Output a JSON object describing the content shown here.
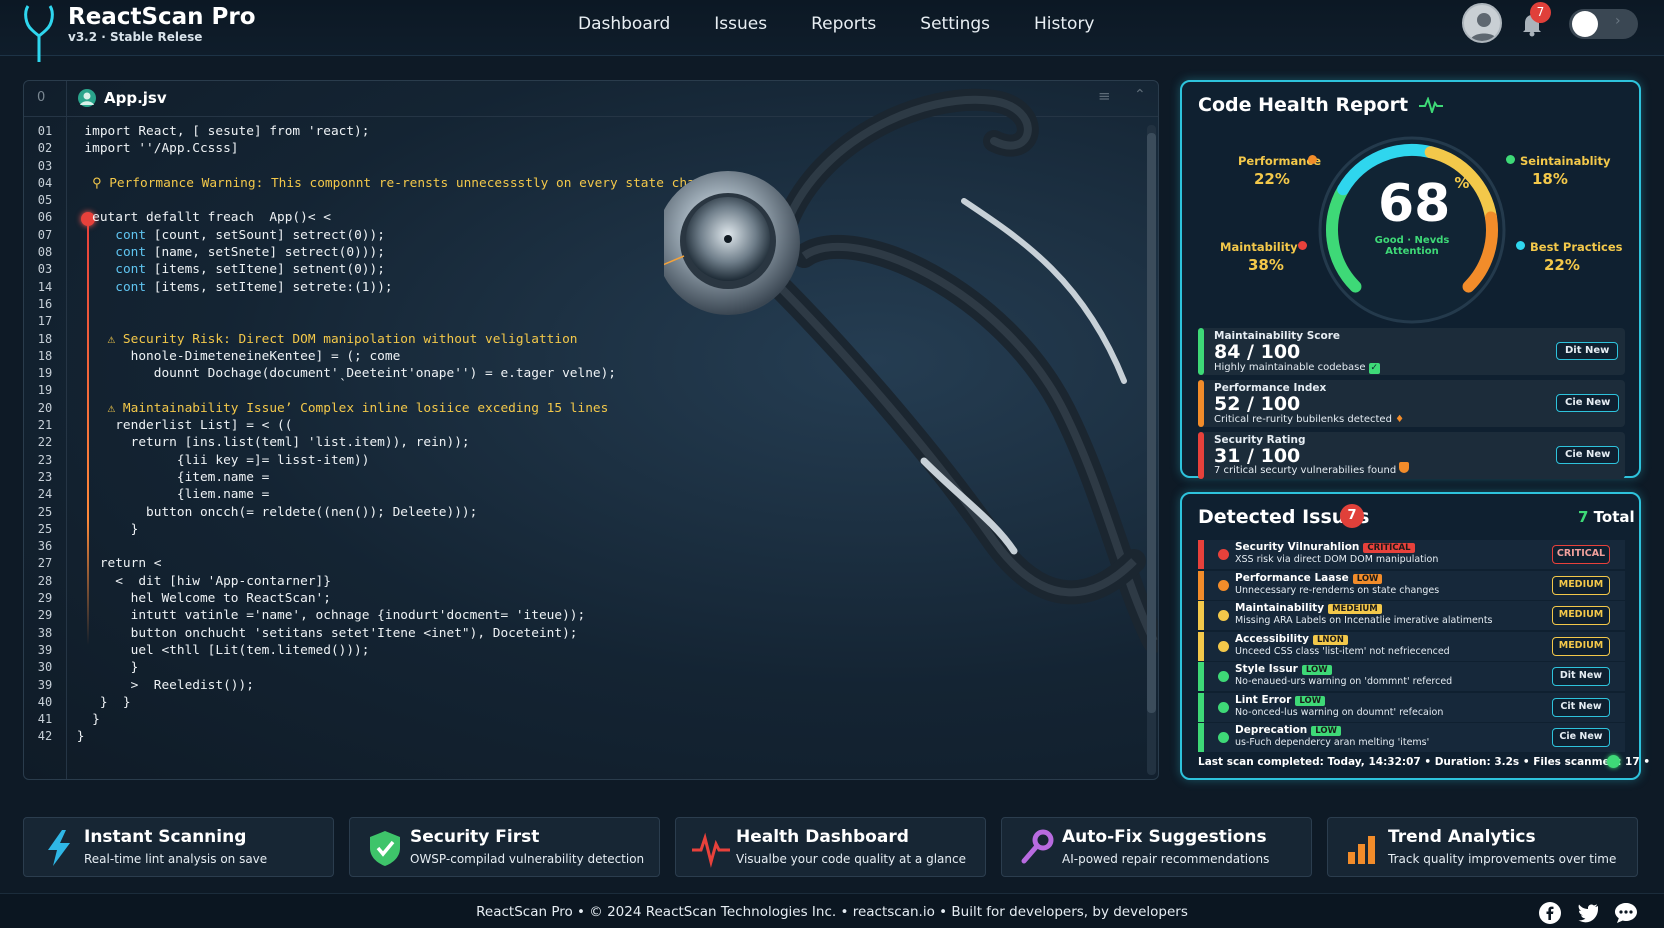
{
  "app": {
    "name": "ReactScan Pro",
    "version": "v3.2 · Stable Relese"
  },
  "nav": {
    "items": [
      {
        "label": "Dashboard",
        "state": "active"
      },
      {
        "label": "Issues",
        "state": "dim"
      },
      {
        "label": "Reports",
        "state": "normal"
      },
      {
        "label": "Settings",
        "state": "normal"
      },
      {
        "label": "History",
        "state": "dim"
      }
    ]
  },
  "header": {
    "notification_count": "7",
    "avatar_icon": "user-avatar-icon",
    "toggle_icon": "theme-toggle"
  },
  "editor": {
    "tab_index": "0",
    "filename": "App.jsv",
    "line_numbers": [
      "01",
      "02",
      "03",
      "04",
      "05",
      "06",
      "07",
      "08",
      "03",
      "14",
      "16",
      "17",
      "18",
      "18",
      "19",
      "19",
      "20",
      "21",
      "22",
      "23",
      "23",
      "24",
      "25",
      "25",
      "36",
      "27",
      "28",
      "29",
      "29",
      "38",
      "39",
      "30",
      "39",
      "40",
      "41",
      "42"
    ],
    "lines": [
      {
        "text": "  import React, [ sesute] from 'react);",
        "kind": "code"
      },
      {
        "text": "  import ''/App.Ccsss]",
        "kind": "code"
      },
      {
        "text": "",
        "kind": "code"
      },
      {
        "text": "   ⚲ Performance Warning: This componnt re-rensts unnecessstly on every state change",
        "kind": "warn"
      },
      {
        "text": "",
        "kind": "code"
      },
      {
        "text": "   eutart defallt freach  App()< <",
        "kind": "code"
      },
      {
        "text": "      cont [count, setSount] setrect(0));",
        "kind": "kw"
      },
      {
        "text": "      cont [name, setSnete] setrect(0)));",
        "kind": "kw"
      },
      {
        "text": "      cont [items, setItene] setnent(0));",
        "kind": "kw"
      },
      {
        "text": "      cont [items, setIteme] setrete:(1));",
        "kind": "kw"
      },
      {
        "text": "",
        "kind": "code"
      },
      {
        "text": "",
        "kind": "code"
      },
      {
        "text": "     ⚠ Security Risk: Direct DOM manipolation without veliglattion",
        "kind": "warn"
      },
      {
        "text": "        honole-DimeteneineKentee] = (; come",
        "kind": "code"
      },
      {
        "text": "           dounnt Dochage(document'ˎDeeteint'onape'') = e.tager velne);",
        "kind": "code"
      },
      {
        "text": "",
        "kind": "code"
      },
      {
        "text": "     ⚠ Maintainability Issue’ Complex inline losiice exceding 15 lines",
        "kind": "warn"
      },
      {
        "text": "      renderlist List] = < ((",
        "kind": "code"
      },
      {
        "text": "        return [ins.list(teml] 'list.item)), rein));",
        "kind": "code"
      },
      {
        "text": "              {lii key =]= lisst-item))",
        "kind": "code"
      },
      {
        "text": "              {item.name =",
        "kind": "code"
      },
      {
        "text": "              {liem.name =",
        "kind": "code"
      },
      {
        "text": "          button oncch(= reldete((nen()); Deleete)));",
        "kind": "code"
      },
      {
        "text": "        }",
        "kind": "code"
      },
      {
        "text": "",
        "kind": "code"
      },
      {
        "text": "    return <",
        "kind": "code"
      },
      {
        "text": "      <  dit [hiw 'App-contarner]}",
        "kind": "code"
      },
      {
        "text": "        hel Welcome to ReactScan';",
        "kind": "code"
      },
      {
        "text": "        intutt vatinle ='name', ochnage {inodurt'docment= 'iteue));",
        "kind": "code"
      },
      {
        "text": "        button onchucht 'setitans setet'Itene <i̇net\"), Doceteint);",
        "kind": "code"
      },
      {
        "text": "        uel <thll [Lit(tem.litemed()));",
        "kind": "code"
      },
      {
        "text": "        }",
        "kind": "code"
      },
      {
        "text": "        >  Reeledist());",
        "kind": "code"
      },
      {
        "text": "    }  }",
        "kind": "code"
      },
      {
        "text": "   }",
        "kind": "code"
      },
      {
        "text": " }",
        "kind": "code"
      }
    ]
  },
  "health": {
    "title": "Code Health Report",
    "score": "68",
    "score_unit": "%",
    "score_status": "Good · Nevds Attention",
    "gauge_fraction": 0.68,
    "metrics": [
      {
        "label": "Performance",
        "value": "22%",
        "color": "#f28c2a"
      },
      {
        "label": "Seintainablity",
        "value": "18%",
        "color": "#3ed977"
      },
      {
        "label": "Maintability",
        "value": "38%",
        "color": "#e8413b"
      },
      {
        "label": "Best Practices",
        "value": "22%",
        "color": "#2fd6ee"
      }
    ],
    "scores": [
      {
        "label": "Maintainability Score",
        "value": "84 / 100",
        "desc": "Highly maintainable codebase",
        "button": "Dit New",
        "color": "#3ed977",
        "icon": "check-icon"
      },
      {
        "label": "Performance Index",
        "value": "52 / 100",
        "desc": "Critical re-rurity bubilenks detected",
        "button": "Cie New",
        "color": "#f28c2a",
        "icon": "flame-icon"
      },
      {
        "label": "Security Rating",
        "value": "31 / 100",
        "desc": "7 critical securty vulnerabilies found",
        "button": "Cie New",
        "color": "#e8413b",
        "icon": "shield-icon"
      }
    ]
  },
  "issues": {
    "title": "Detected Issues",
    "count": "7",
    "total_num": "7",
    "total_word": "Total",
    "rows": [
      {
        "name": "Security Vilnurahlion",
        "tag": "CRITICAL",
        "tag_color": "#e8413b",
        "desc": "XSS risk via direct DOM DOM manipulation",
        "button": "CRITICAL",
        "btn_style": "sev",
        "dot": "#e8413b",
        "bar": "#e8413b"
      },
      {
        "name": "Performance Laase",
        "tag": "LOW",
        "tag_color": "#f28c2a",
        "desc": "Unnecessary re-renderns on state changes",
        "button": "MEDIUM",
        "btn_style": "sev",
        "dot": "#f28c2a",
        "bar": "#f28c2a"
      },
      {
        "name": "Maintainability",
        "tag": "MEDEIUM",
        "tag_color": "#f3c84a",
        "desc": "Missing ARA Labels on Incenatlie imerative alatiments",
        "button": "MEDIUM",
        "btn_style": "sev",
        "dot": "#f3c84a",
        "bar": "#f3c84a"
      },
      {
        "name": "Accessibility",
        "tag": "LNON",
        "tag_color": "#f3c84a",
        "desc": "Unceed CSS class 'list-item' not nefriecenced",
        "button": "MEDIUM",
        "btn_style": "sev",
        "dot": "#f3c84a",
        "bar": "#f3c84a"
      },
      {
        "name": "Style Issur",
        "tag": "LOW",
        "tag_color": "#3ed977",
        "desc": "No-enaued-urs warning on 'dommnt' referced",
        "button": "Dit New",
        "btn_style": "plain",
        "dot": "#3ed977",
        "bar": "#3ed977"
      },
      {
        "name": "Lint Error",
        "tag": "LOW",
        "tag_color": "#3ed977",
        "desc": "No-onced-lus warning on doumnt' refecaion",
        "button": "Cit New",
        "btn_style": "plain",
        "dot": "#3ed977",
        "bar": "#3ed977"
      },
      {
        "name": "Deprecation",
        "tag": "LOW",
        "tag_color": "#3ed977",
        "desc": "us-Fuch dependercy aran melting 'items'",
        "button": "Cie New",
        "btn_style": "plain",
        "dot": "#3ed977",
        "bar": "#3ed977"
      }
    ],
    "scan_footer": "Last scan completed: Today, 14:32:07  •  Duration: 3.2s  •  Files scanmed: 17  •"
  },
  "features": [
    {
      "title": "Instant Scanning",
      "desc": "Real-time lint analysis on save",
      "icon": "lightning-icon"
    },
    {
      "title": "Security First",
      "desc": "OWSP-compilad vulnerability detection",
      "icon": "shield-check-icon"
    },
    {
      "title": "Health Dashboard",
      "desc": "Visualbe your code quality at a glance",
      "icon": "heartbeat-icon"
    },
    {
      "title": "Auto-Fix Suggestions",
      "desc": "AI-powed repair recommendations",
      "icon": "wrench-icon"
    },
    {
      "title": "Trend Analytics",
      "desc": "Track quality improvements over time",
      "icon": "bar-chart-icon"
    }
  ],
  "footer": {
    "text": "ReactScan Pro  •  © 2024 ReactScan Technologies Inc.  •  reactscan.io  •  Built for developers, by developers",
    "social": [
      "facebook-icon",
      "twitter-icon",
      "chat-icon"
    ]
  }
}
